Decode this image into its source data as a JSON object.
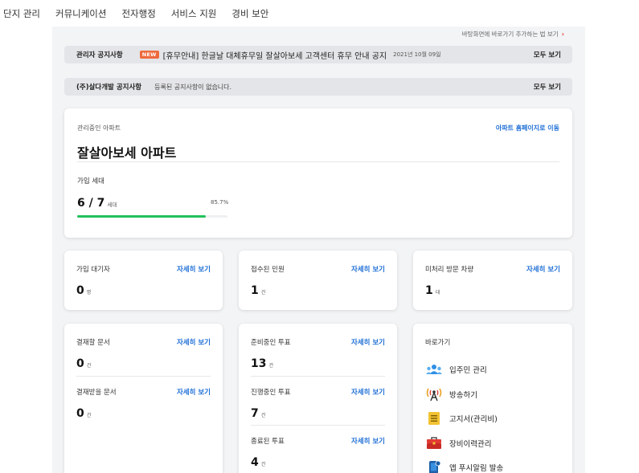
{
  "topnav": {
    "items": [
      "단지 관리",
      "커뮤니케이션",
      "전자행정",
      "서비스 지원",
      "경비 보안"
    ]
  },
  "shortcut_hint": {
    "text": "바탕화면에 바로가기 추가하는 법 보기",
    "arrow": "›"
  },
  "notices": [
    {
      "title": "관리자 공지사항",
      "badge": "NEW",
      "text": "[휴무안내] 한글날 대체휴무일 잘살아보세 고객센터 휴무 안내 공지",
      "date": "2021년 10월 09일",
      "more": "모두 보기"
    },
    {
      "title": "(주)살다개발 공지사항",
      "empty": "등록된 공지사항이 없습니다.",
      "more": "모두 보기"
    }
  ],
  "apartment": {
    "label": "관리중인 아파트",
    "homepage_link": "아파트 홈페이지로 이동",
    "name": "잘살아보세 아파트",
    "households_label": "가입 세대",
    "households_value": "6 / 7",
    "households_unit": "세대",
    "percent_text": "85.7%",
    "progress": 0.857
  },
  "cards": {
    "pending_signup": {
      "label": "가입 대기자",
      "more": "자세히 보기",
      "value": "0",
      "unit": "명"
    },
    "complaints": {
      "label": "접수된 민원",
      "more": "자세히 보기",
      "value": "1",
      "unit": "건"
    },
    "visitor_cars": {
      "label": "미처리 방문 차량",
      "more": "자세히 보기",
      "value": "1",
      "unit": "대"
    },
    "approvals": {
      "to_approve": {
        "label": "결재할 문서",
        "more": "자세히 보기",
        "value": "0",
        "unit": "건"
      },
      "to_receive": {
        "label": "결재받을 문서",
        "more": "자세히 보기",
        "value": "0",
        "unit": "건"
      }
    },
    "votes": {
      "preparing": {
        "label": "준비중인 투표",
        "more": "자세히 보기",
        "value": "13",
        "unit": "건"
      },
      "ongoing": {
        "label": "진행중인 투표",
        "more": "자세히 보기",
        "value": "7",
        "unit": "건"
      },
      "ended": {
        "label": "종료된 투표",
        "more": "자세히 보기",
        "value": "4",
        "unit": "건"
      }
    },
    "shortcuts": {
      "title": "바로가기",
      "items": [
        {
          "label": "입주민 관리",
          "icon": "residents-icon"
        },
        {
          "label": "방송하기",
          "icon": "broadcast-icon"
        },
        {
          "label": "고지서(관리비)",
          "icon": "bill-icon"
        },
        {
          "label": "장비이력관리",
          "icon": "toolbox-icon"
        },
        {
          "label": "앱 푸시알림 발송",
          "icon": "push-notification-icon"
        }
      ]
    }
  },
  "colors": {
    "accent_blue": "#1f6fd6",
    "progress_green": "#22c05c",
    "new_badge": "#ee6a3d",
    "hint_arrow": "#e03b2f"
  }
}
